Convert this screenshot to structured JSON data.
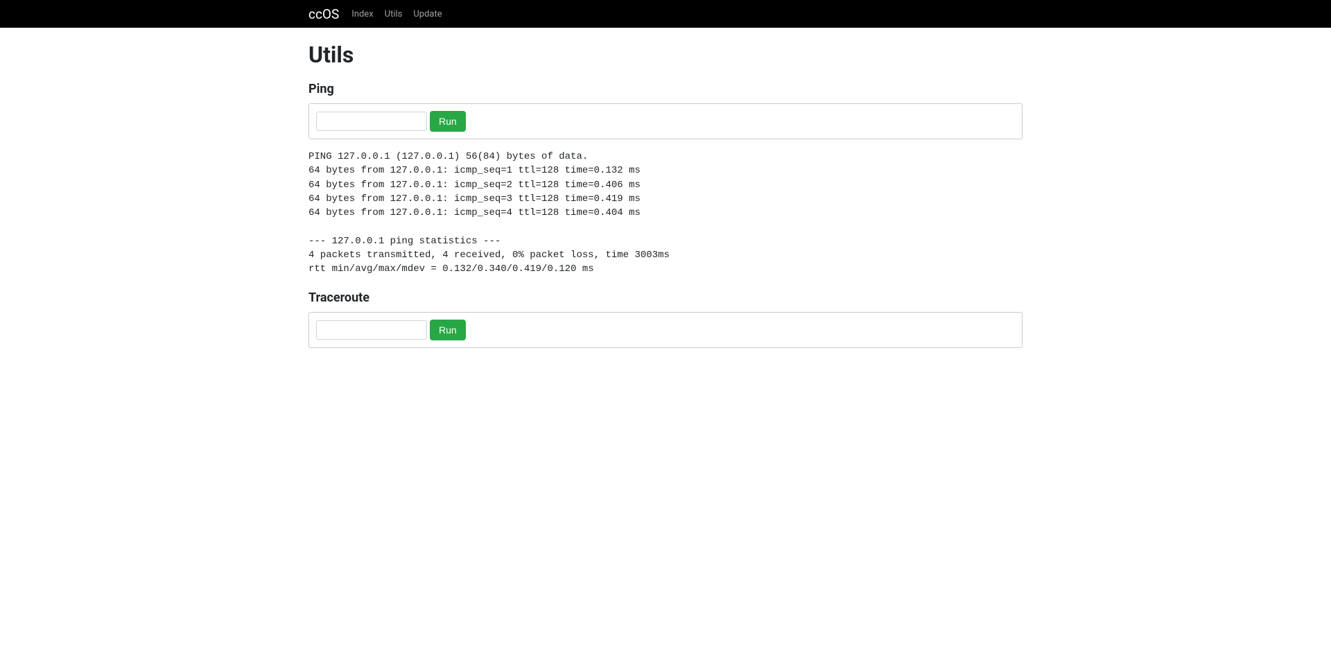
{
  "navbar": {
    "brand": "ccOS",
    "links": [
      {
        "label": "Index"
      },
      {
        "label": "Utils"
      },
      {
        "label": "Update"
      }
    ]
  },
  "page": {
    "title": "Utils"
  },
  "ping": {
    "heading": "Ping",
    "input_value": "",
    "run_label": "Run",
    "output": "PING 127.0.0.1 (127.0.0.1) 56(84) bytes of data.\n64 bytes from 127.0.0.1: icmp_seq=1 ttl=128 time=0.132 ms\n64 bytes from 127.0.0.1: icmp_seq=2 ttl=128 time=0.406 ms\n64 bytes from 127.0.0.1: icmp_seq=3 ttl=128 time=0.419 ms\n64 bytes from 127.0.0.1: icmp_seq=4 ttl=128 time=0.404 ms\n\n--- 127.0.0.1 ping statistics ---\n4 packets transmitted, 4 received, 0% packet loss, time 3003ms\nrtt min/avg/max/mdev = 0.132/0.340/0.419/0.120 ms"
  },
  "traceroute": {
    "heading": "Traceroute",
    "input_value": "",
    "run_label": "Run"
  }
}
